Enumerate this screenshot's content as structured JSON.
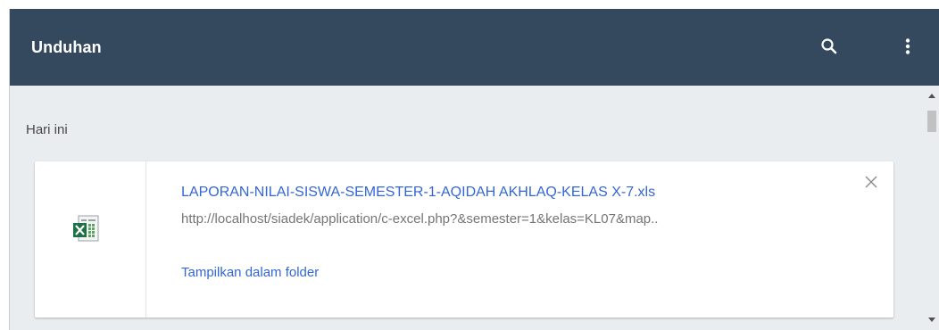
{
  "header": {
    "title": "Unduhan",
    "background": "#34495e",
    "search_icon": "search-icon",
    "menu_icon": "more-vertical-icon"
  },
  "section": {
    "label": "Hari ini"
  },
  "download": {
    "file_name": "LAPORAN-NILAI-SISWA-SEMESTER-1-AQIDAH AKHLAQ-KELAS X-7.xls",
    "url": "http://localhost/siadek/application/c-excel.php?&semester=1&kelas=KL07&map..",
    "action_label": "Tampilkan dalam folder",
    "file_icon": "excel-file-icon",
    "remove_icon": "close-icon",
    "link_color": "#3367d6"
  }
}
